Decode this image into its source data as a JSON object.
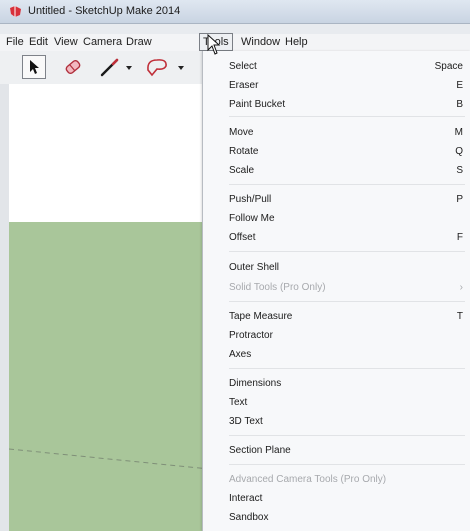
{
  "window": {
    "title": "Untitled - SketchUp Make 2014",
    "app_icon": "sketchup-logo-icon"
  },
  "menubar": {
    "items": [
      "File",
      "Edit",
      "View",
      "Camera",
      "Draw",
      "Tools",
      "Window",
      "Help"
    ],
    "open_menu": "Tools"
  },
  "toolbar": {
    "tools": [
      {
        "icon": "select-arrow-icon",
        "pressed": true
      },
      {
        "icon": "eraser-icon"
      },
      {
        "icon": "pencil-line-icon",
        "has_dropdown": true
      },
      {
        "icon": "shape-icon",
        "has_dropdown": true
      }
    ]
  },
  "tools_menu": {
    "items": [
      {
        "label": "Select",
        "shortcut": "Space"
      },
      {
        "label": "Eraser",
        "shortcut": "E"
      },
      {
        "label": "Paint Bucket",
        "shortcut": "B"
      },
      {
        "label": "Move",
        "shortcut": "M"
      },
      {
        "label": "Rotate",
        "shortcut": "Q"
      },
      {
        "label": "Scale",
        "shortcut": "S"
      },
      {
        "label": "Push/Pull",
        "shortcut": "P"
      },
      {
        "label": "Follow Me",
        "shortcut": ""
      },
      {
        "label": "Offset",
        "shortcut": "F"
      },
      {
        "label": "Outer Shell",
        "shortcut": ""
      },
      {
        "label": "Solid Tools (Pro Only)",
        "shortcut": "",
        "disabled": true
      },
      {
        "label": "Tape Measure",
        "shortcut": "T"
      },
      {
        "label": "Protractor",
        "shortcut": ""
      },
      {
        "label": "Axes",
        "shortcut": ""
      },
      {
        "label": "Dimensions",
        "shortcut": ""
      },
      {
        "label": "Text",
        "shortcut": ""
      },
      {
        "label": "3D Text",
        "shortcut": ""
      },
      {
        "label": "Section Plane",
        "shortcut": ""
      },
      {
        "label": "Advanced Camera Tools (Pro Only)",
        "shortcut": "",
        "disabled": true
      },
      {
        "label": "Interact",
        "shortcut": ""
      },
      {
        "label": "Sandbox",
        "shortcut": ""
      }
    ]
  },
  "colors": {
    "sky": "#ffffff",
    "ground": "#a9c69a",
    "menu_bg": "#f7f8fa",
    "disabled_text": "#a7a9ad"
  }
}
